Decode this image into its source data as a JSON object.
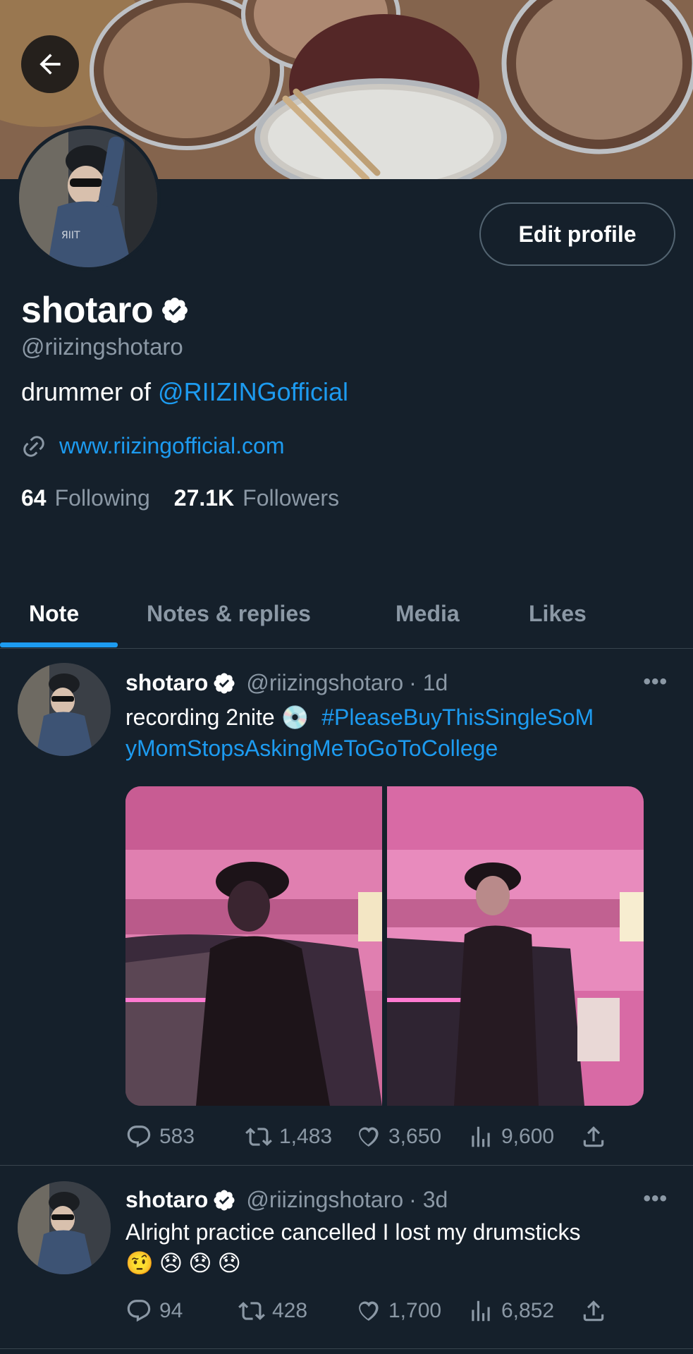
{
  "header": {
    "back_label": "Back"
  },
  "profile": {
    "display_name": "shotaro",
    "handle": "@riizingshotaro",
    "bio_prefix": "drummer of ",
    "bio_mention": "@RIIZINGofficial",
    "website": "www.riizingofficial.com",
    "following_count": "64",
    "following_label": "Following",
    "followers_count": "27.1K",
    "followers_label": "Followers",
    "edit_label": "Edit profile"
  },
  "tabs": [
    {
      "label": "Note",
      "active": true
    },
    {
      "label": "Notes & replies",
      "active": false
    },
    {
      "label": "Media",
      "active": false
    },
    {
      "label": "Likes",
      "active": false
    }
  ],
  "posts": [
    {
      "name": "shotaro",
      "handle": "@riizingshotaro",
      "time": "· 1d",
      "text": "recording 2nite 💿",
      "hashtag_line1": "#PleaseBuyThisSingleSoM",
      "hashtag_line2": "yMomStopsAskingMeToGoToCollege",
      "replies": "583",
      "reposts": "1,483",
      "likes": "3,650",
      "views": "9,600"
    },
    {
      "name": "shotaro",
      "handle": "@riizingshotaro",
      "time": "· 3d",
      "text": "Alright practice cancelled I lost my drumsticks",
      "emoji_line": "🤨😞😞😞",
      "replies": "94",
      "reposts": "428",
      "likes": "1,700",
      "views": "6,852"
    }
  ],
  "colors": {
    "background": "#15202b",
    "accent": "#1d9bf0",
    "muted": "#8b98a5",
    "divider": "#38444d"
  }
}
